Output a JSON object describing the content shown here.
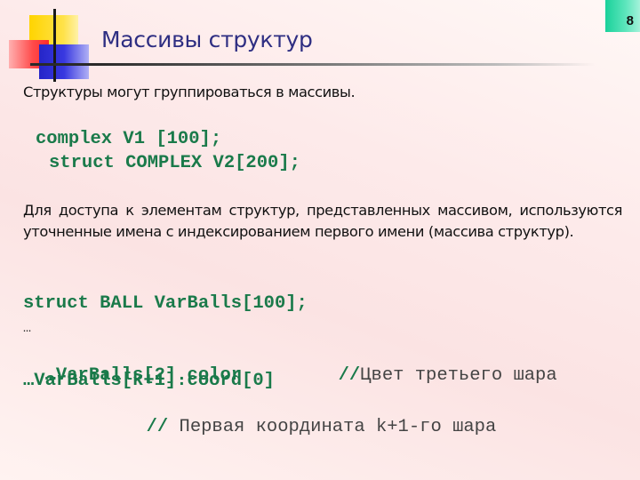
{
  "slide": {
    "title": "Массивы структур",
    "page_number": "8",
    "accent_colors": {
      "title": "#2e2e82",
      "code": "#1a7a4a",
      "page_badge": "#19d19a"
    }
  },
  "intro_text": "Структуры могут группироваться в массивы.",
  "code_block_1": [
    "complex V1 [100];",
    "struct COMPLEX V2[200];"
  ],
  "paragraph": "Для доступа к элементам структур, представленных массивом, используются уточненные имена с индексированием первого имени (массива структур).",
  "code_block_2": {
    "line1": "struct BALL VarBalls[100];",
    "line2": "…",
    "line3_code": "…VarBalls[2].color",
    "line3_slashes": "//",
    "line3_comment": "Цвет третьего шара",
    "line4_code": "…VarBalls[k+1].coord[0]",
    "line5_slashes": "//",
    "line5_comment": " Первая координата k+1-го шара"
  }
}
